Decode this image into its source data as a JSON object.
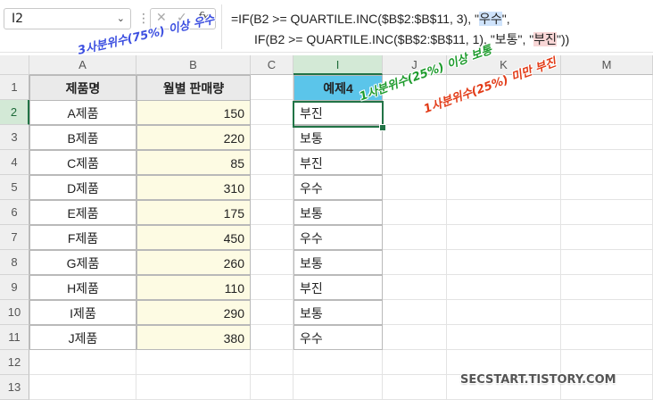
{
  "name_box": {
    "value": "I2"
  },
  "formula": {
    "line1_a": "=IF(B2 >= QUARTILE.INC($B$2:$B$11, 3), \"",
    "line1_hl": "우수",
    "line1_b": "\",",
    "line2_a": "IF(B2 >= QUARTILE.INC($B$2:$B$11, 1), \"보통\", \"",
    "line2_hl": "부진",
    "line2_b": "\"))",
    "fx_label": "fx",
    "cancel_icon": "x-icon",
    "enter_icon": "check-icon"
  },
  "columns": [
    "A",
    "B",
    "C",
    "I",
    "J",
    "K",
    "M"
  ],
  "rows": [
    "1",
    "2",
    "3",
    "4",
    "5",
    "6",
    "7",
    "8",
    "9",
    "10",
    "11",
    "12",
    "13"
  ],
  "table": {
    "header_name": "제품명",
    "header_sales": "월별 판매량",
    "header_ex": "예제4",
    "products": [
      "A제품",
      "B제품",
      "C제품",
      "D제품",
      "E제품",
      "F제품",
      "G제품",
      "H제품",
      "I제품",
      "J제품"
    ],
    "sales": [
      "150",
      "220",
      "85",
      "310",
      "175",
      "450",
      "260",
      "110",
      "290",
      "380"
    ],
    "results": [
      "부진",
      "보통",
      "부진",
      "우수",
      "보통",
      "우수",
      "보통",
      "부진",
      "보통",
      "우수"
    ]
  },
  "annotations": {
    "top": "3사분위수(75%) 이상 우수",
    "mid": "1사분위수(25%) 이상 보통",
    "low": "1사분위수(25%) 미만 부진"
  },
  "watermark": "SECSTART.TISTORY.COM",
  "colors": {
    "header_gray": "#eaeaea",
    "header_blue": "#5bc5ea",
    "sales_fill": "#fdfbe3",
    "selection": "#217346",
    "ann_blue": "#3c4fe0",
    "ann_green": "#1e9b2d",
    "ann_red": "#e23a16"
  }
}
